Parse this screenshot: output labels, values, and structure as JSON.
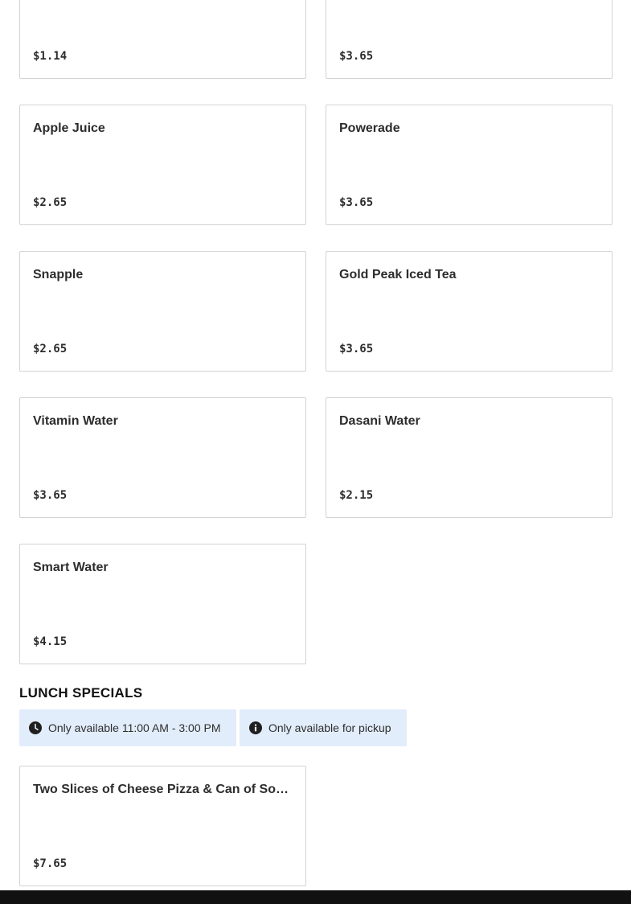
{
  "top_cards": [
    {
      "price": "$1.14"
    },
    {
      "price": "$3.65"
    }
  ],
  "menu_items": [
    {
      "name": "Apple Juice",
      "price": "$2.65"
    },
    {
      "name": "Powerade",
      "price": "$3.65"
    },
    {
      "name": "Snapple",
      "price": "$2.65"
    },
    {
      "name": "Gold Peak Iced Tea",
      "price": "$3.65"
    },
    {
      "name": "Vitamin Water",
      "price": "$3.65"
    },
    {
      "name": "Dasani Water",
      "price": "$2.15"
    },
    {
      "name": "Smart Water",
      "price": "$4.15"
    }
  ],
  "lunch_specials": {
    "title": "LUNCH SPECIALS",
    "hours_notice": "Only available 11:00 AM - 3:00 PM",
    "pickup_notice": "Only available for pickup",
    "hours_icon": "clock-icon",
    "pickup_icon": "info-icon",
    "items": [
      {
        "name": "Two Slices of Cheese Pizza & Can of Soda Combo",
        "price": "$7.65"
      }
    ]
  },
  "colors": {
    "card_border": "#d3d3d3",
    "notice_background": "#e2edfb",
    "bottom_bar": "#111111"
  }
}
